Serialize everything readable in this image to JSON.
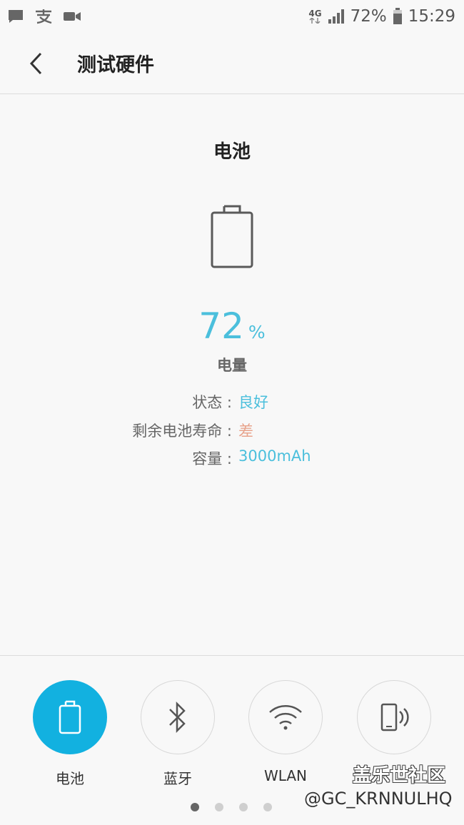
{
  "status_bar": {
    "network_type": "4G",
    "battery_percent_text": "72%",
    "time": "15:29",
    "icons": [
      "message-icon",
      "alipay-icon",
      "video-icon",
      "signal-icon",
      "battery-icon"
    ]
  },
  "header": {
    "title": "测试硬件",
    "back_icon": "chevron-left-icon"
  },
  "main": {
    "section_title": "电池",
    "battery_icon": "battery-outline-icon",
    "percent_value": "72",
    "percent_unit": "%",
    "level_label": "电量",
    "info": [
      {
        "label": "状态 : ",
        "value": "良好",
        "status": "good"
      },
      {
        "label": "剩余电池寿命 : ",
        "value": "差",
        "status": "bad"
      },
      {
        "label": "容量 : ",
        "value": "3000mAh",
        "status": "good"
      }
    ]
  },
  "tabs": [
    {
      "label": "电池",
      "icon": "battery-icon",
      "active": true
    },
    {
      "label": "蓝牙",
      "icon": "bluetooth-icon",
      "active": false
    },
    {
      "label": "WLAN",
      "icon": "wifi-icon",
      "active": false
    },
    {
      "label": "",
      "icon": "phone-vibrate-icon",
      "active": false
    }
  ],
  "pager": {
    "count": 4,
    "active_index": 0
  },
  "watermark": {
    "line1": "盖乐世社区",
    "line2": "@GC_KRNNULHQ"
  },
  "colors": {
    "accent": "#12b1e0",
    "value_good": "#4bbfdc",
    "value_bad": "#e8a48d"
  }
}
